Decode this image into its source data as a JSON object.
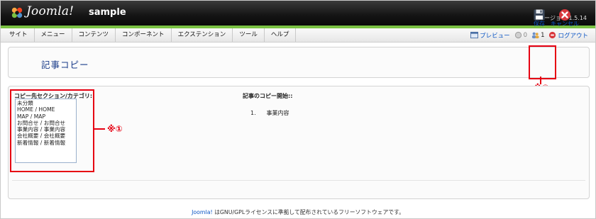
{
  "header": {
    "brand": "Joomla!",
    "site_name": "sample",
    "version": "バージョン 1.5.14"
  },
  "menu": [
    "サイト",
    "メニュー",
    "コンテンツ",
    "コンポーネント",
    "エクステンション",
    "ツール",
    "ヘルプ"
  ],
  "status": {
    "preview": "プレビュー",
    "messages": "0",
    "users": "1",
    "logout": "ログアウト"
  },
  "toolbar": {
    "title": "記事コピー",
    "save": "保存",
    "cancel": "キャンセル"
  },
  "annotations": {
    "note1": "※①",
    "note2": "※②"
  },
  "form": {
    "category_label": "コピー先セクション/カテゴリ:",
    "categories": [
      "未分類",
      "HOME / HOME",
      "MAP / MAP",
      "お問合せ / お問合せ",
      "事業内容 / 事業内容",
      "会社概要 / 会社概要",
      "新着情報 / 新着情報"
    ],
    "copy_heading": "記事のコピー開始::",
    "copy_items": [
      {
        "num": "1.",
        "title": "事業内容"
      }
    ]
  },
  "footer": {
    "link": "Joomla!",
    "text": " はGNU/GPLライセンスに準拠して配布されているフリーソフトウェアです。"
  },
  "colors": {
    "accent_green": "#7ac143",
    "annotation_red": "#e60012",
    "link_blue": "#0b55c4"
  }
}
